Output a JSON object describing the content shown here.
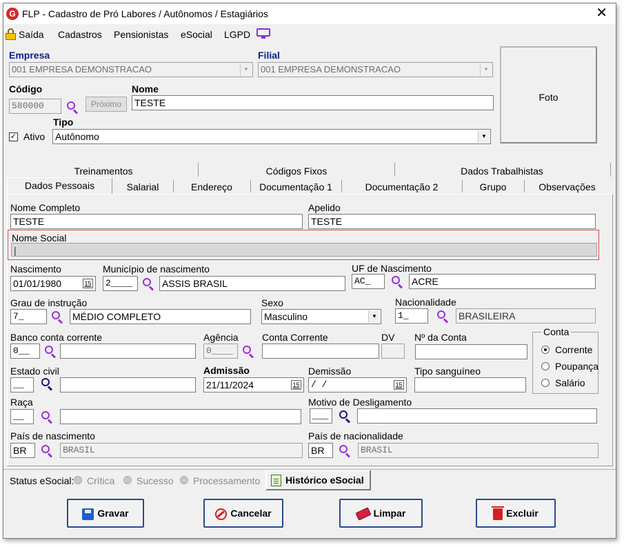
{
  "window": {
    "title": "FLP - Cadastro de Pró Labores / Autônomos / Estagiários",
    "close_label": "✕"
  },
  "menu": {
    "saida": "Saída",
    "cadastros": "Cadastros",
    "pensionistas": "Pensionistas",
    "esocial": "eSocial",
    "lgpd": "LGPD"
  },
  "header": {
    "empresa_label": "Empresa",
    "empresa_value": "001 EMPRESA DEMONSTRACAO",
    "filial_label": "Filial",
    "filial_value": "001 EMPRESA DEMONSTRACAO",
    "codigo_label": "Código",
    "codigo_value": "580000",
    "proximo_label": "Próximo",
    "nome_label": "Nome",
    "nome_value": "TESTE",
    "ativo_label": "Ativo",
    "ativo_checked": true,
    "tipo_label": "Tipo",
    "tipo_value": "Autônomo",
    "foto_label": "Foto"
  },
  "tabs_back": [
    "Treinamentos",
    "Códigos Fixos",
    "Dados Trabalhistas"
  ],
  "tabs_front": [
    "Dados Pessoais",
    "Salarial",
    "Endereço",
    "Documentação 1",
    "Documentação 2",
    "Grupo",
    "Observações"
  ],
  "active_tab": "Dados Pessoais",
  "form": {
    "nome_completo_label": "Nome Completo",
    "nome_completo_value": "TESTE",
    "apelido_label": "Apelido",
    "apelido_value": "TESTE",
    "nome_social_label": "Nome Social",
    "nome_social_value": "|",
    "nascimento_label": "Nascimento",
    "nascimento_value": "01/01/1980",
    "municipio_label": "Município de nascimento",
    "municipio_code": "2____",
    "municipio_name": "ASSIS BRASIL",
    "uf_label": "UF de Nascimento",
    "uf_code": "AC_",
    "uf_name": "ACRE",
    "grau_label": "Grau de instrução",
    "grau_code": "7_",
    "grau_name": "MÉDIO COMPLETO",
    "sexo_label": "Sexo",
    "sexo_value": "Masculino",
    "nacionalidade_label": "Nacionalidade",
    "nacionalidade_code": "1_",
    "nacionalidade_name": "BRASILEIRA",
    "banco_label": "Banco conta corrente",
    "banco_code": "0__",
    "banco_name": "",
    "agencia_label": "Agência",
    "agencia_value": "0____",
    "conta_corrente_label": "Conta Corrente",
    "conta_corrente_value": "",
    "dv_label": "DV",
    "dv_value": "",
    "nr_conta_label": "Nº da Conta",
    "nr_conta_value": "",
    "estado_civil_label": "Estado civil",
    "estado_civil_code": "__",
    "estado_civil_name": "",
    "admissao_label": "Admissão",
    "admissao_value": "21/11/2024",
    "demissao_label": "Demissão",
    "demissao_value": " / /",
    "tipo_sanguineo_label": "Tipo sanguíneo",
    "tipo_sanguineo_value": "",
    "raca_label": "Raça",
    "raca_code": "__",
    "raca_name": "",
    "motivo_label": "Motivo de Desligamento",
    "motivo_code": "___",
    "motivo_name": "",
    "pais_nasc_label": "País de nascimento",
    "pais_nasc_code": "BR",
    "pais_nasc_name": "BRASIL",
    "pais_nac_label": "País de nacionalidade",
    "pais_nac_code": "BR",
    "pais_nac_name": "BRASIL",
    "conta_group_label": "Conta",
    "conta_options": [
      "Corrente",
      "Poupança",
      "Salário"
    ],
    "conta_selected": "Corrente",
    "calendar_glyph": "15"
  },
  "status": {
    "label": "Status eSocial:",
    "options": [
      "Crítica",
      "Sucesso",
      "Processamento"
    ],
    "historico_label": "Histórico eSocial"
  },
  "actions": {
    "gravar": "Gravar",
    "cancelar": "Cancelar",
    "limpar": "Limpar",
    "excluir": "Excluir"
  },
  "colors": {
    "menu_label_blue": "#0a1e8c",
    "search_purple": "#9b30d9",
    "highlight_red": "#e04848",
    "button_border": "#2a4a8a"
  }
}
